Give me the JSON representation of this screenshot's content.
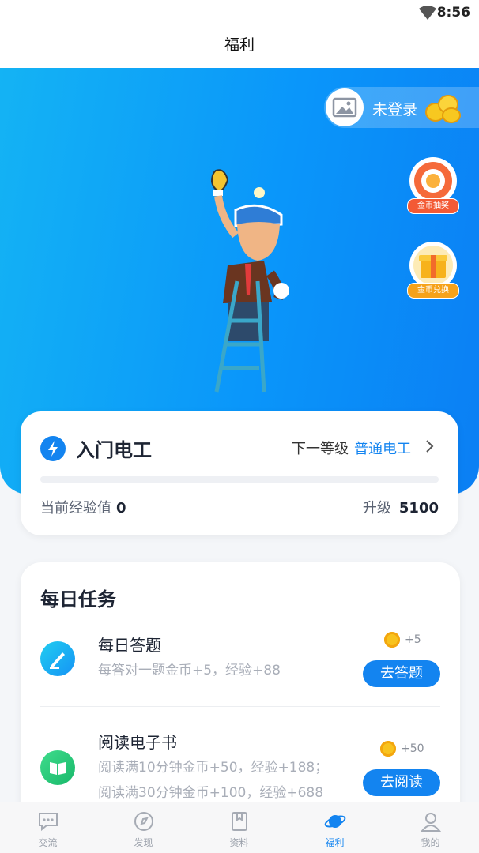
{
  "status": {
    "time": "8:56"
  },
  "header": {
    "title": "福利"
  },
  "hero": {
    "login_text": "未登录",
    "lottery_label": "金币抽奖",
    "exchange_label": "金币兑换"
  },
  "level": {
    "name": "入门电工",
    "next_label": "下一等级",
    "next_level": "普通电工",
    "exp_label": "当前经验值",
    "exp_value": "0",
    "upgrade_label": "升级",
    "upgrade_value": "5100",
    "progress": 0
  },
  "tasks": {
    "title": "每日任务",
    "items": [
      {
        "name": "每日答题",
        "desc": "每答对一题金币+5，经验+88",
        "reward": "+5",
        "button": "去答题"
      },
      {
        "name": "阅读电子书",
        "desc1": "阅读满10分钟金币+50，经验+188；",
        "desc2": "阅读满30分钟金币+100，经验+688",
        "reward": "+50",
        "button": "去阅读"
      }
    ]
  },
  "tabbar": {
    "items": [
      {
        "label": "交流",
        "icon": "chat-icon"
      },
      {
        "label": "发现",
        "icon": "discover-icon"
      },
      {
        "label": "资料",
        "icon": "book-icon"
      },
      {
        "label": "福利",
        "icon": "planet-icon"
      },
      {
        "label": "我的",
        "icon": "user-icon"
      }
    ],
    "active": "福利"
  },
  "colors": {
    "accent": "#1384f0",
    "hero_start": "#14b3f4",
    "hero_end": "#0b7ff4"
  }
}
